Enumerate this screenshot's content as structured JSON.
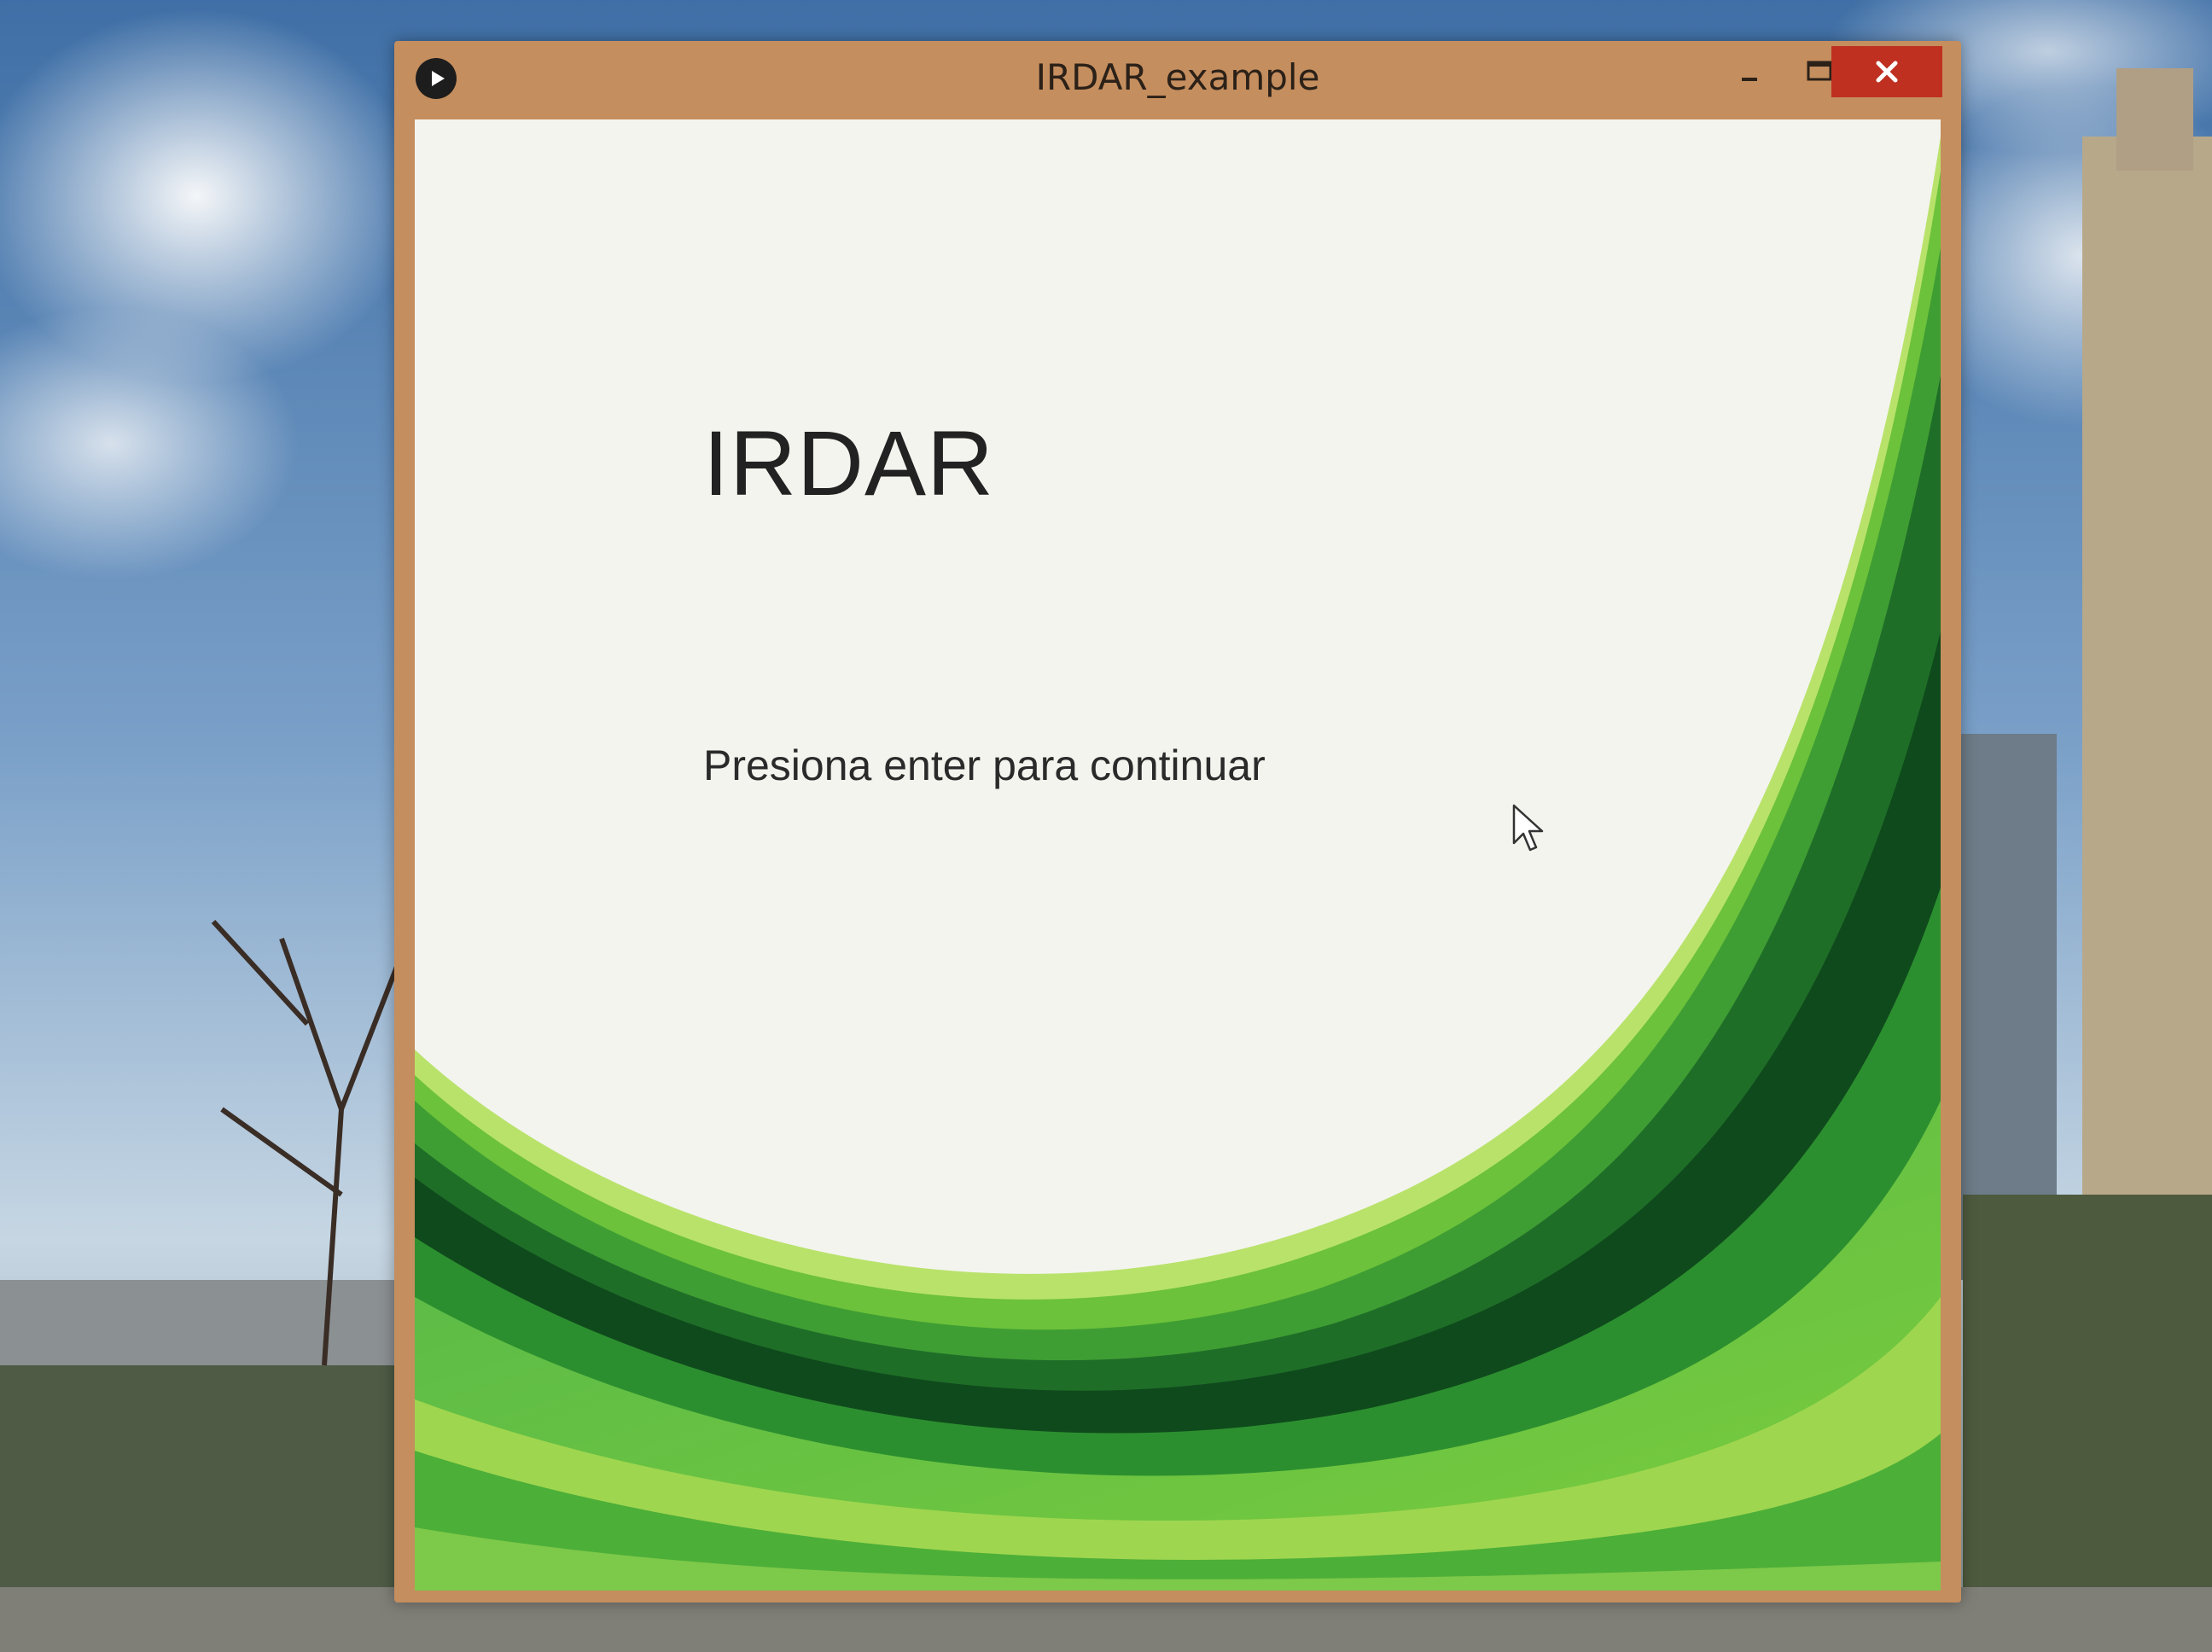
{
  "window": {
    "title": "IRDAR_example"
  },
  "title_bar_buttons": {
    "minimize": "minimize-icon",
    "maximize": "maximize-icon",
    "close": "close-icon"
  },
  "content": {
    "heading": "IRDAR",
    "prompt": "Presiona enter para continuar"
  },
  "colors": {
    "title_bar": "#c58e5e",
    "close_button": "#bf3021",
    "client_background": "#f3f4ee",
    "green_dark": "#0f4a1c",
    "green_mid": "#2f9a2f",
    "green_light": "#8fd14a",
    "green_pale": "#cbe98a"
  }
}
